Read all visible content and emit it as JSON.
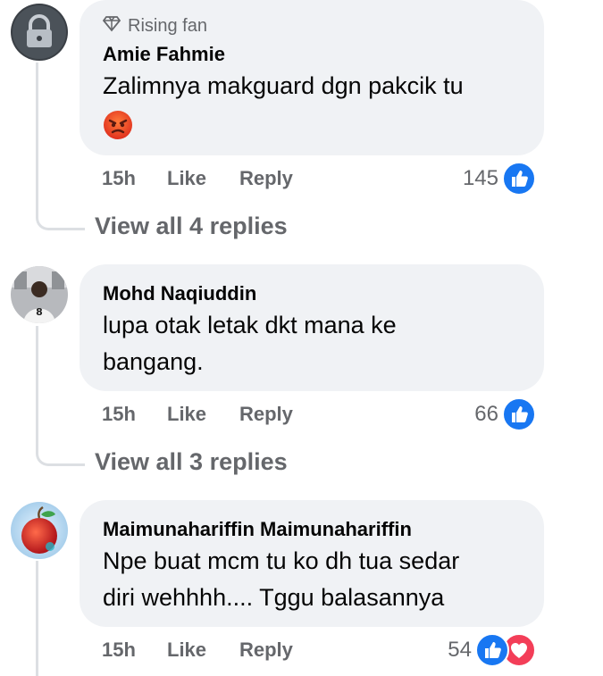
{
  "comments": [
    {
      "badge_label": "Rising fan",
      "badge_icon": "diamond-icon",
      "author": "Amie Fahmie",
      "text": "Zalimnya makguard dgn pakcik tu",
      "emoji": "angry-face-emoji",
      "time": "15h",
      "like_label": "Like",
      "reply_label": "Reply",
      "reaction_count": "145",
      "reactions": [
        "like-reaction-icon"
      ],
      "view_replies": "View all 4 replies"
    },
    {
      "author": "Mohd Naqiuddin",
      "text_line1": "lupa otak letak dkt mana ke",
      "text_line2": "bangang.",
      "time": "15h",
      "like_label": "Like",
      "reply_label": "Reply",
      "reaction_count": "66",
      "reactions": [
        "like-reaction-icon"
      ],
      "view_replies": "View all 3 replies"
    },
    {
      "author": "Maimunahariffin Maimunahariffin",
      "text_line1": "Npe buat mcm tu ko dh tua sedar",
      "text_line2": "diri wehhhh.... Tggu balasannya",
      "time": "15h",
      "like_label": "Like",
      "reply_label": "Reply",
      "reaction_count": "54",
      "reactions": [
        "like-reaction-icon",
        "love-reaction-icon"
      ]
    }
  ],
  "colors": {
    "bubble_bg": "#f0f2f5",
    "secondary_text": "#65676b",
    "like_blue": "#1877f2",
    "love_red": "#f33e58"
  }
}
